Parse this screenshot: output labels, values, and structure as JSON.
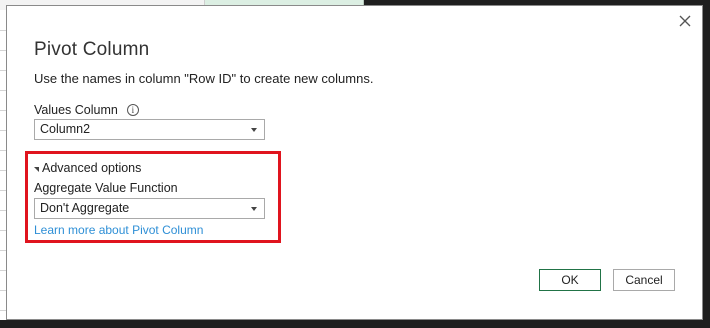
{
  "dialog": {
    "title": "Pivot Column",
    "description": "Use the names in column \"Row ID\" to create new columns.",
    "close_icon": "close-icon",
    "values_column": {
      "label": "Values Column",
      "info_icon": "i",
      "selected": "Column2"
    },
    "advanced": {
      "toggle_label": "Advanced options",
      "aggregate_label": "Aggregate Value Function",
      "aggregate_selected": "Don't Aggregate",
      "learn_more": "Learn more about Pivot Column",
      "highlight_color": "#e0141e"
    },
    "buttons": {
      "ok": "OK",
      "cancel": "Cancel"
    },
    "colors": {
      "link": "#2e8fd6",
      "ok_border": "#217346"
    }
  }
}
